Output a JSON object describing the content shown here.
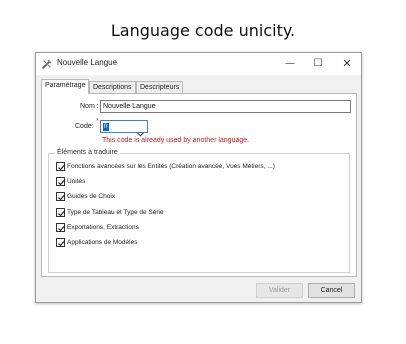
{
  "caption": "Language code unicity.",
  "window": {
    "title": "Nouvelle Langue",
    "controls": {
      "minimize": "—",
      "maximize": "☐",
      "close": "✕"
    }
  },
  "tabs": [
    {
      "label": "Paramétrage",
      "active": true
    },
    {
      "label": "Descriptions",
      "active": false
    },
    {
      "label": "Descripteurs",
      "active": false
    }
  ],
  "form": {
    "name_label": "Nom :",
    "name_value": "Nouvelle Langue",
    "code_label": "Code:",
    "code_required_mark": "*",
    "code_value": "fr",
    "error_message": "This code is already used by another language."
  },
  "elements_group": {
    "title": "Éléments à traduire",
    "items": [
      {
        "label": "Fonctions avancées sur les Entités (Création avancée, Vues Métiers, ...)",
        "checked": true
      },
      {
        "label": "Unités",
        "checked": true
      },
      {
        "label": "Guides de Choix",
        "checked": true
      },
      {
        "label": "Type de Tableau et Type de Série",
        "checked": true
      },
      {
        "label": "Exportations, Extractions",
        "checked": true
      },
      {
        "label": "Applications de Modèles",
        "checked": true
      }
    ]
  },
  "buttons": {
    "validate": "Valider",
    "validate_enabled": false,
    "cancel": "Cancel"
  }
}
